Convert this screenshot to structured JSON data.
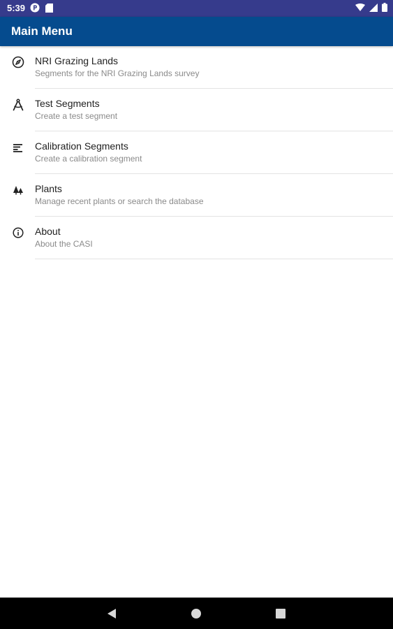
{
  "status_bar": {
    "time": "5:39",
    "icons": [
      "p-circle-icon",
      "sd-card-icon",
      "wifi-icon",
      "signal-icon",
      "battery-icon"
    ]
  },
  "app_bar": {
    "title": "Main Menu",
    "background_color": "#054b8e"
  },
  "menu": {
    "items": [
      {
        "icon": "compass-icon",
        "title": "NRI Grazing Lands",
        "subtitle": "Segments for the NRI Grazing Lands survey"
      },
      {
        "icon": "drafting-compass-icon",
        "title": "Test Segments",
        "subtitle": "Create a test segment"
      },
      {
        "icon": "sort-lines-icon",
        "title": "Calibration Segments",
        "subtitle": "Create a calibration segment"
      },
      {
        "icon": "trees-icon",
        "title": "Plants",
        "subtitle": "Manage recent plants or search the database"
      },
      {
        "icon": "info-icon",
        "title": "About",
        "subtitle": "About the CASI"
      }
    ]
  },
  "nav_bar": {
    "buttons": [
      "back-icon",
      "home-icon",
      "recents-icon"
    ]
  },
  "colors": {
    "status_bar": "#363b8c",
    "app_bar": "#054b8e",
    "title_text": "#212121",
    "subtitle_text": "#8a8a8a"
  }
}
